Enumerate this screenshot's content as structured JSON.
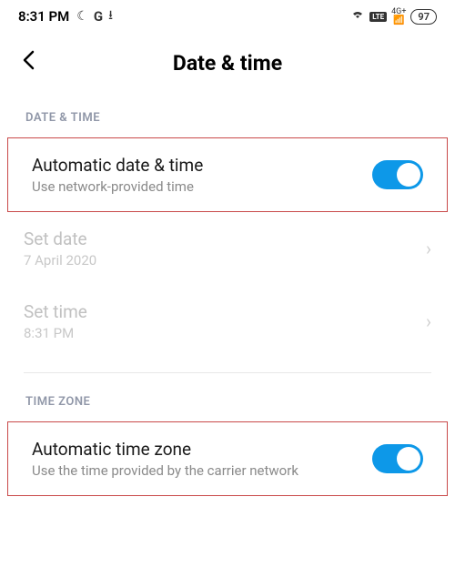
{
  "status": {
    "time": "8:31 PM",
    "battery": "97",
    "network": "4G+",
    "lte": "LTE"
  },
  "header": {
    "title": "Date & time"
  },
  "sections": {
    "date_time_label": "DATE & TIME",
    "time_zone_label": "TIME ZONE"
  },
  "settings": {
    "auto_date": {
      "title": "Automatic date & time",
      "subtitle": "Use network-provided time",
      "enabled": true
    },
    "set_date": {
      "title": "Set date",
      "subtitle": "7 April 2020"
    },
    "set_time": {
      "title": "Set time",
      "subtitle": "8:31 PM"
    },
    "auto_tz": {
      "title": "Automatic time zone",
      "subtitle": "Use the time provided by the carrier network",
      "enabled": true
    }
  }
}
